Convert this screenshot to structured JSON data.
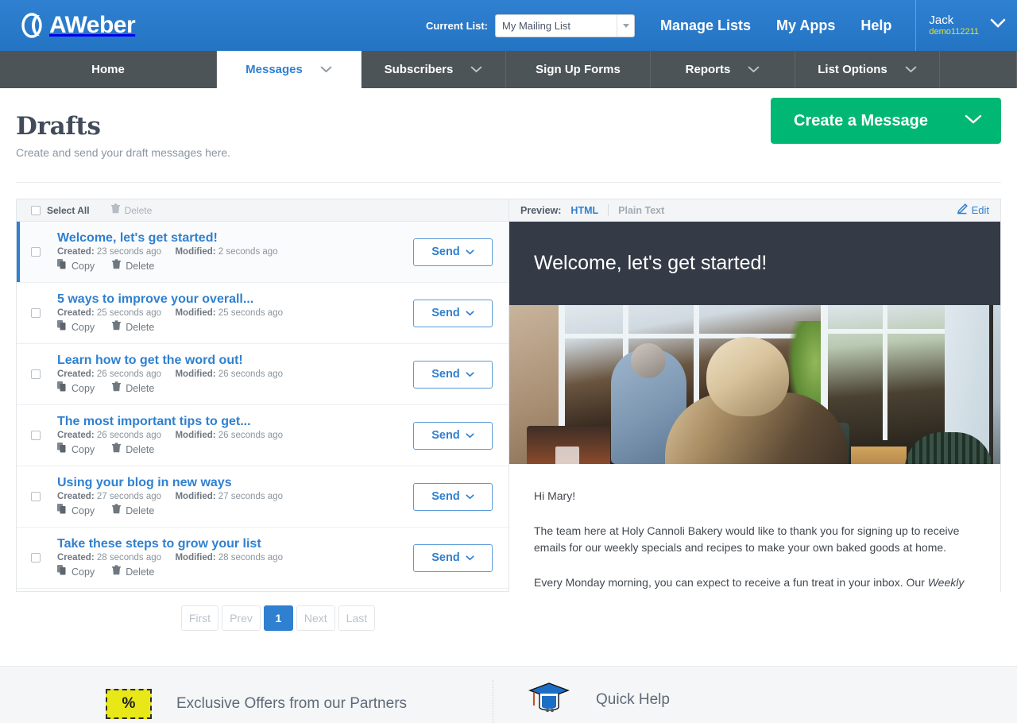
{
  "brand": {
    "name": "AWeber",
    "logo_icon": "aweber-logo-icon"
  },
  "topbar": {
    "current_list_label": "Current List:",
    "current_list_value": "My Mailing List",
    "current_list_placeholder": "My Mailing List",
    "links": [
      {
        "label": "Manage Lists",
        "name": "manage-lists-link"
      },
      {
        "label": "My Apps",
        "name": "my-apps-link"
      },
      {
        "label": "Help",
        "name": "help-link"
      }
    ],
    "user": {
      "name": "Jack",
      "account_id": "demo112211",
      "id_color": "#dbe442"
    },
    "bg_color": "#2f80d0"
  },
  "mainnav": {
    "items": [
      {
        "label": "Home",
        "active": false,
        "caret": false
      },
      {
        "label": "Messages",
        "active": true,
        "caret": true
      },
      {
        "label": "Subscribers",
        "active": false,
        "caret": true
      },
      {
        "label": "Sign Up Forms",
        "active": false,
        "caret": false
      },
      {
        "label": "Reports",
        "active": false,
        "caret": true
      },
      {
        "label": "List Options",
        "active": false,
        "caret": true
      }
    ],
    "bg_color": "#4d5458",
    "active_color": "#2f80d0"
  },
  "page": {
    "title": "Drafts",
    "subtitle": "Create and send your draft messages here.",
    "create_button": {
      "label": "Create a Message",
      "color": "#00b873",
      "caret_icon": "chevron-down-icon"
    }
  },
  "list_toolbar": {
    "select_all_label": "Select All",
    "delete_label": "Delete",
    "delete_icon": "trash-icon"
  },
  "drafts": [
    {
      "title": "Welcome, let's get started!",
      "created_label": "Created:",
      "created_value": "23 seconds ago",
      "modified_label": "Modified:",
      "modified_value": "2 seconds ago",
      "copy_label": "Copy",
      "delete_label": "Delete",
      "send_label": "Send",
      "selected": true
    },
    {
      "title": "5 ways to improve your overall...",
      "created_label": "Created:",
      "created_value": "25 seconds ago",
      "modified_label": "Modified:",
      "modified_value": "25 seconds ago",
      "copy_label": "Copy",
      "delete_label": "Delete",
      "send_label": "Send",
      "selected": false
    },
    {
      "title": "Learn how to get the word out!",
      "created_label": "Created:",
      "created_value": "26 seconds ago",
      "modified_label": "Modified:",
      "modified_value": "26 seconds ago",
      "copy_label": "Copy",
      "delete_label": "Delete",
      "send_label": "Send",
      "selected": false
    },
    {
      "title": "The most important tips to get...",
      "created_label": "Created:",
      "created_value": "26 seconds ago",
      "modified_label": "Modified:",
      "modified_value": "26 seconds ago",
      "copy_label": "Copy",
      "delete_label": "Delete",
      "send_label": "Send",
      "selected": false
    },
    {
      "title": "Using your blog in new ways",
      "created_label": "Created:",
      "created_value": "27 seconds ago",
      "modified_label": "Modified:",
      "modified_value": "27 seconds ago",
      "copy_label": "Copy",
      "delete_label": "Delete",
      "send_label": "Send",
      "selected": false
    },
    {
      "title": "Take these steps to grow your list",
      "created_label": "Created:",
      "created_value": "28 seconds ago",
      "modified_label": "Modified:",
      "modified_value": "28 seconds ago",
      "copy_label": "Copy",
      "delete_label": "Delete",
      "send_label": "Send",
      "selected": false
    }
  ],
  "preview": {
    "label": "Preview:",
    "tab_html": "HTML",
    "tab_plain": "Plain Text",
    "active_tab": "HTML",
    "edit_label": "Edit",
    "edit_icon": "pencil-icon",
    "email": {
      "banner_heading": "Welcome, let's get started!",
      "banner_bg": "#343a46",
      "image_alt": "cafe-photo",
      "greeting": "Hi Mary!",
      "paragraph_1": "The team here at Holy Cannoli Bakery would like to thank you for signing up to receive emails for our weekly specials and recipes to make your own baked goods at home.",
      "paragraph_2_prefix": "Every Monday morning, you can expect to receive a fun treat in your inbox. Our ",
      "paragraph_2_italic": "Weekly"
    }
  },
  "pagination": {
    "first": "First",
    "prev": "Prev",
    "next": "Next",
    "last": "Last",
    "current_page": "1"
  },
  "footer": {
    "offers_title": "Exclusive Offers from our Partners",
    "offers_icon": "coupon-percent-icon",
    "offers_icon_text": "%",
    "help_title": "Quick Help",
    "help_icon": "graduation-cap-icon"
  }
}
